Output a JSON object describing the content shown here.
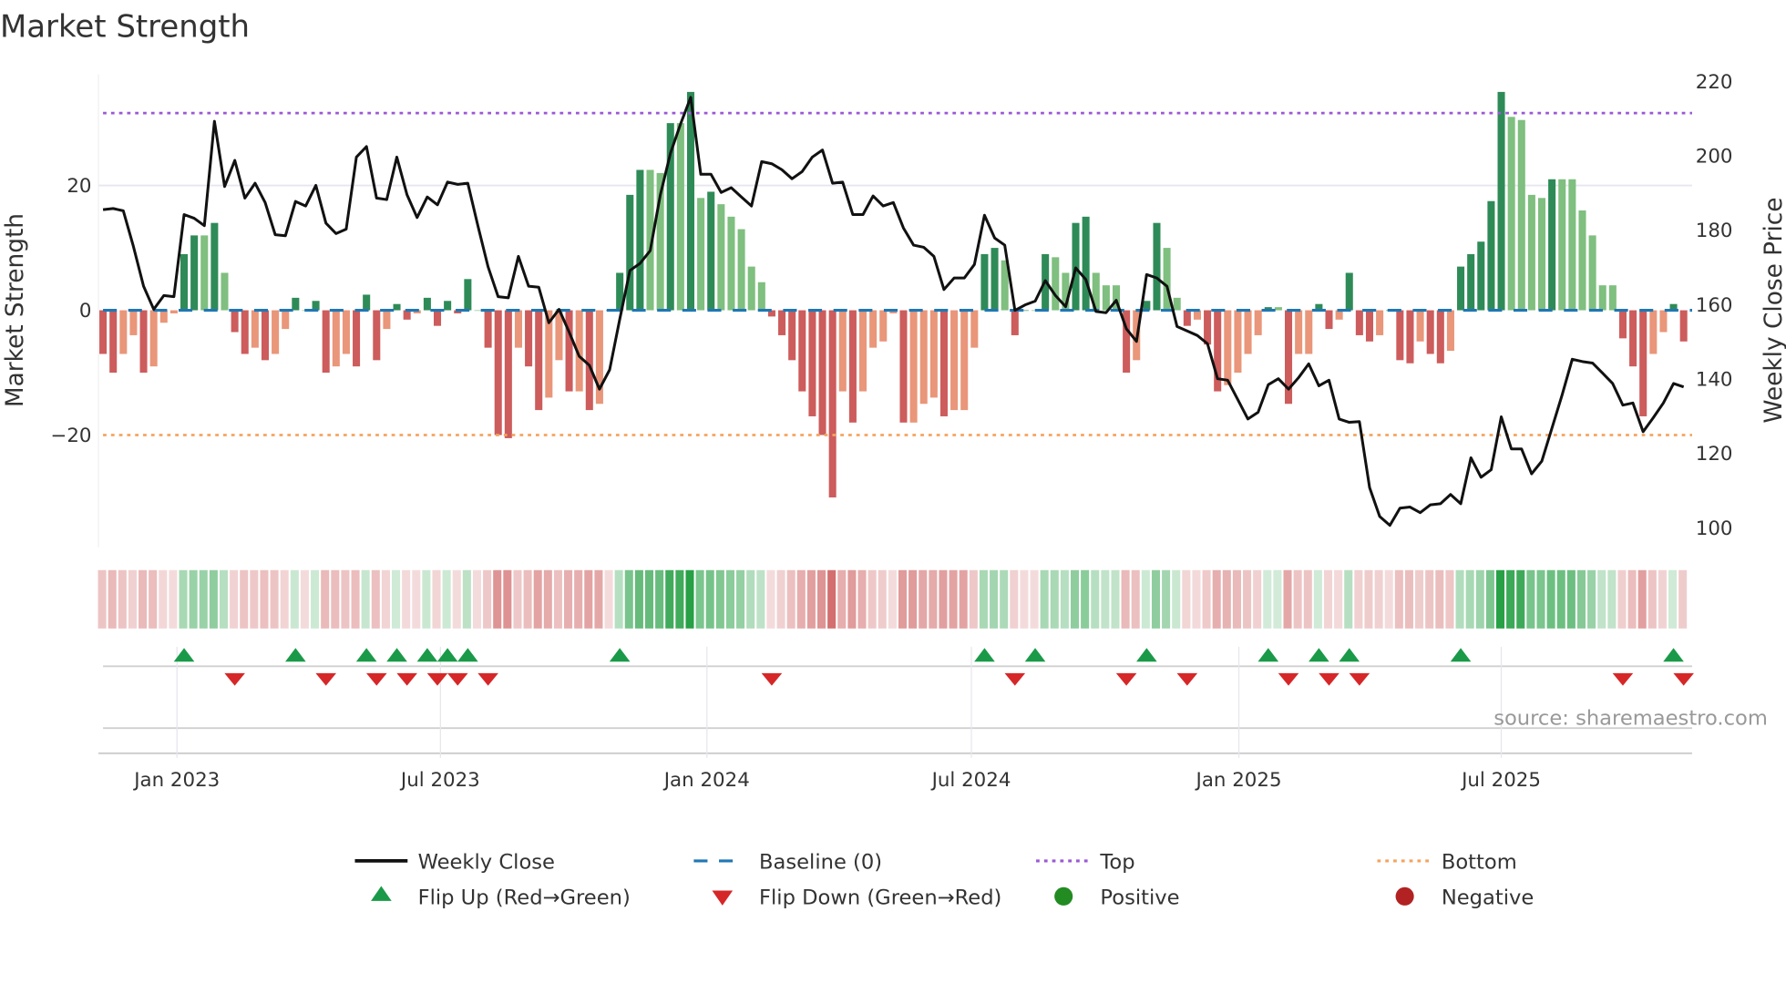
{
  "chart_data": {
    "type": "bar",
    "title": "Market Strength",
    "ylabel": "Market Strength",
    "y2label": "Weekly Close Price",
    "ylim": [
      -38,
      38
    ],
    "y2lim": [
      95,
      222
    ],
    "yticks_left": [
      "20",
      "0",
      "−20"
    ],
    "yticks_left_values": [
      20,
      0,
      -20
    ],
    "yticks_right": [
      "220",
      "200",
      "180",
      "160",
      "140",
      "120",
      "100"
    ],
    "yticks_right_values": [
      220,
      200,
      180,
      160,
      140,
      120,
      100
    ],
    "xticks": [
      "Jan 2023",
      "Jul 2023",
      "Jan 2024",
      "Jul 2024",
      "Jan 2025",
      "Jul 2025"
    ],
    "xticks_week_index": [
      7.3,
      33.3,
      59.6,
      85.7,
      112.1,
      138
    ],
    "top_level": 31.6,
    "bottom_level": -20,
    "baseline": 0,
    "strength": [
      -7,
      -10,
      -7,
      -4,
      -10,
      -9,
      -2,
      -0.5,
      9,
      12,
      12,
      14,
      6,
      -3.5,
      -7,
      -6,
      -8,
      -7,
      -3,
      2,
      0,
      1.5,
      -10,
      -9,
      -7,
      -9,
      2.5,
      -8,
      -3,
      1,
      -1.5,
      -0.5,
      2,
      -2.5,
      1.5,
      -0.5,
      5,
      0,
      -6,
      -20,
      -20.5,
      -6,
      -9,
      -16,
      -14,
      -8,
      -13,
      -13,
      -16,
      -15,
      0,
      6,
      18.5,
      22.5,
      22.5,
      22,
      30,
      30,
      35,
      18,
      19,
      17,
      15,
      13,
      7,
      4.5,
      -1,
      -4,
      -8,
      -13,
      -17,
      -20,
      -30,
      -13,
      -18,
      -13,
      -6,
      -5,
      -0.5,
      -18,
      -18,
      -15,
      -14,
      -17,
      -16,
      -16,
      -6,
      9,
      10,
      8,
      -4,
      0,
      0,
      9,
      8.5,
      6,
      14,
      15,
      6,
      4,
      4,
      -10,
      -8,
      1.5,
      14,
      10,
      2,
      -2.5,
      -1.5,
      -5.5,
      -13,
      -12,
      -10,
      -7,
      -4,
      0.5,
      0.5,
      -15,
      -7,
      -7,
      1,
      -3,
      -1.5,
      6,
      -4,
      -5,
      -4,
      0,
      -8,
      -8.5,
      -5,
      -7,
      -8.5,
      -6.5,
      7,
      9,
      11,
      17.5,
      35,
      31,
      30.5,
      18.5,
      18,
      21,
      21,
      21,
      16,
      12,
      4,
      4,
      -4.5,
      -9,
      -17,
      -7,
      -3.5,
      1,
      -5
    ],
    "weekly_close": [
      185.3,
      185.6,
      185,
      175.5,
      164.8,
      158.6,
      162.3,
      162,
      184,
      183,
      181,
      209,
      191.5,
      198.5,
      188.4,
      192.4,
      187.2,
      178.6,
      178.3,
      187.5,
      186.3,
      191.8,
      181.7,
      178.9,
      180.1,
      199.4,
      202.2,
      188.4,
      188,
      199.4,
      189.3,
      183.2,
      188.7,
      186.6,
      192.7,
      192.1,
      192.4,
      181,
      170,
      162,
      161.7,
      172.8,
      164.8,
      164.5,
      155,
      158.6,
      152.5,
      146,
      143.6,
      137.2,
      142.4,
      155.9,
      169,
      170.9,
      174.3,
      189.3,
      200.4,
      208.3,
      215.4,
      194.8,
      194.8,
      189.9,
      191.2,
      188.7,
      186.3,
      198.2,
      197.6,
      196,
      193.6,
      195.5,
      199.4,
      201.3,
      192.4,
      192.7,
      184,
      184,
      189,
      186.3,
      187.2,
      180.4,
      175.8,
      175.2,
      172.8,
      163.9,
      167,
      167,
      170.6,
      183.8,
      177.7,
      175.8,
      158.3,
      159.8,
      160.8,
      166.3,
      162.3,
      159.3,
      169.7,
      166.6,
      158,
      157.7,
      161,
      153.4,
      150,
      167.9,
      167,
      164.8,
      154,
      152.8,
      151.6,
      149.4,
      140,
      139.6,
      134.4,
      129.2,
      131,
      138.4,
      140,
      137.2,
      140.3,
      144,
      138.1,
      139.6,
      129.2,
      128.3,
      128.5,
      110.8,
      103.1,
      100.7,
      105.3,
      105.6,
      104.1,
      106.2,
      106.5,
      109,
      106.5,
      118.8,
      113.6,
      115.6,
      129.8,
      121.2,
      121.2,
      114.5,
      117.9,
      126.7,
      135.6,
      145.2,
      144.6,
      144.2,
      141.5,
      138.7,
      132.9,
      133.5,
      125.8,
      129.5,
      133.5,
      138.7,
      137.8
    ],
    "flip_up_week_index": [
      8,
      19,
      26,
      29,
      32,
      34,
      36,
      51,
      87,
      92,
      103,
      115,
      120,
      123,
      134,
      155
    ],
    "flip_down_week_index": [
      13,
      22,
      27,
      30,
      33,
      35,
      38,
      66,
      90,
      101,
      107,
      117,
      121,
      124,
      150,
      156
    ],
    "legend": {
      "placement": "bottom",
      "items": [
        {
          "label": "Weekly Close",
          "kind": "line"
        },
        {
          "label": "Baseline (0)",
          "kind": "dash"
        },
        {
          "label": "Top",
          "kind": "dot-top"
        },
        {
          "label": "Bottom",
          "kind": "dot-bottom"
        },
        {
          "label": "Flip Up (Red→Green)",
          "kind": "tri-up"
        },
        {
          "label": "Flip Down (Green→Red)",
          "kind": "tri-down"
        },
        {
          "label": "Positive",
          "kind": "dot-pos"
        },
        {
          "label": "Negative",
          "kind": "dot-neg"
        }
      ]
    },
    "source": "source: sharemaestro.com"
  },
  "colors": {
    "pos_strong": "#2e8b57",
    "pos_weak": "#7fbf7f",
    "neg_strong": "#cd5c5c",
    "neg_weak": "#e9967a",
    "line": "#111111",
    "baseline": "#1f77b4",
    "top": "#9b59d6",
    "bottom": "#f4a460",
    "flip_up": "#1a9a48",
    "flip_down": "#d62728",
    "positive": "#228b22",
    "negative": "#b22222"
  }
}
